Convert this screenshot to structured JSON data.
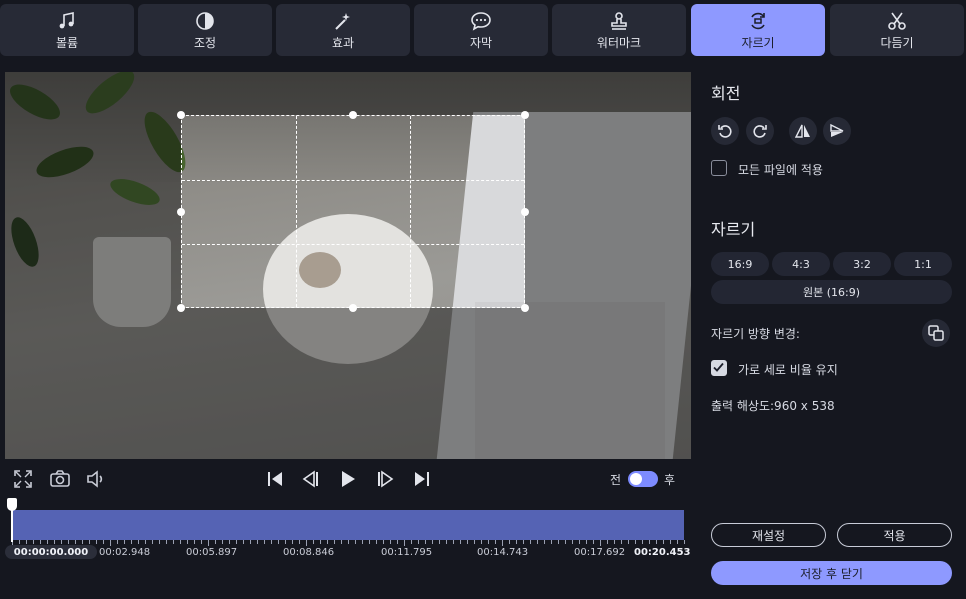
{
  "tabs": [
    {
      "label": "볼륨",
      "icon": "music-note-icon"
    },
    {
      "label": "조정",
      "icon": "contrast-icon"
    },
    {
      "label": "효과",
      "icon": "magic-wand-icon"
    },
    {
      "label": "자막",
      "icon": "speech-bubble-icon"
    },
    {
      "label": "워터마크",
      "icon": "stamp-icon"
    },
    {
      "label": "자르기",
      "icon": "crop-rotate-icon"
    },
    {
      "label": "다듬기",
      "icon": "scissors-icon"
    }
  ],
  "active_tab": "자르기",
  "sidebar": {
    "rotate_title": "회전",
    "apply_all_label": "모든 파일에 적용",
    "apply_all_checked": false,
    "crop_title": "자르기",
    "ratios": [
      "16:9",
      "4:3",
      "3:2",
      "1:1"
    ],
    "original_ratio": "원본 (16:9)",
    "crop_direction_label": "자르기 방향 변경:",
    "keep_ratio_label": "가로 세로 비율 유지",
    "keep_ratio_checked": true,
    "output_resolution": "출력 해상도:960 x 538",
    "reset_label": "재설정",
    "apply_label": "적용",
    "save_close_label": "저장 후 닫기"
  },
  "player": {
    "before_label": "전",
    "after_label": "후"
  },
  "timeline": {
    "current_time": "00:00:00.000",
    "labels": [
      "00:02.948",
      "00:05.897",
      "00:08.846",
      "00:11.795",
      "00:14.743",
      "00:17.692"
    ],
    "end_time": "00:20.453"
  },
  "colors": {
    "accent": "#8e99ff",
    "panel": "#272a36",
    "background": "#15171f",
    "timeline": "#5563b4"
  }
}
